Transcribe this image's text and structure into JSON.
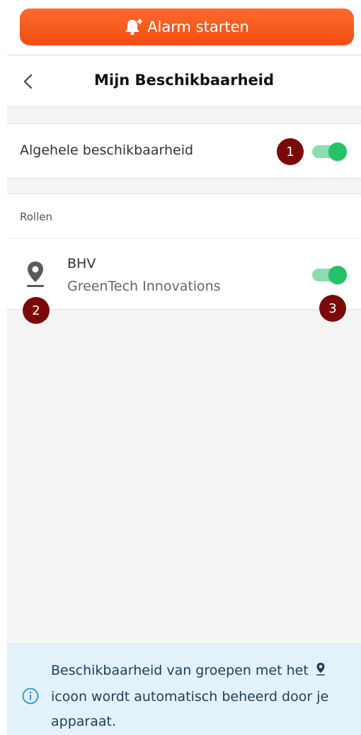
{
  "alarm": {
    "label": "Alarm starten",
    "icon": "bell-plus-icon"
  },
  "header": {
    "title": "Mijn Beschikbaarheid",
    "back_icon": "chevron-left-icon"
  },
  "overall": {
    "label": "Algehele beschikbaarheid",
    "enabled": true,
    "badge": "1"
  },
  "roles": {
    "heading": "Rollen",
    "items": [
      {
        "name": "BHV",
        "organization": "GreenTech Innovations",
        "icon": "location-pin-icon",
        "enabled": true,
        "icon_badge": "2",
        "toggle_badge": "3"
      }
    ]
  },
  "info": {
    "text_before_icon": "Beschikbaarheid van groepen met het",
    "text_after_icon": "icoon wordt automatisch beheerd door je apparaat.",
    "icon": "info-icon",
    "inline_icon": "location-pin-icon"
  },
  "colors": {
    "accent": "#f4561a",
    "toggle_on": "#24c26a",
    "badge": "#7a0a0a",
    "info_bg": "#e3f1fa"
  }
}
